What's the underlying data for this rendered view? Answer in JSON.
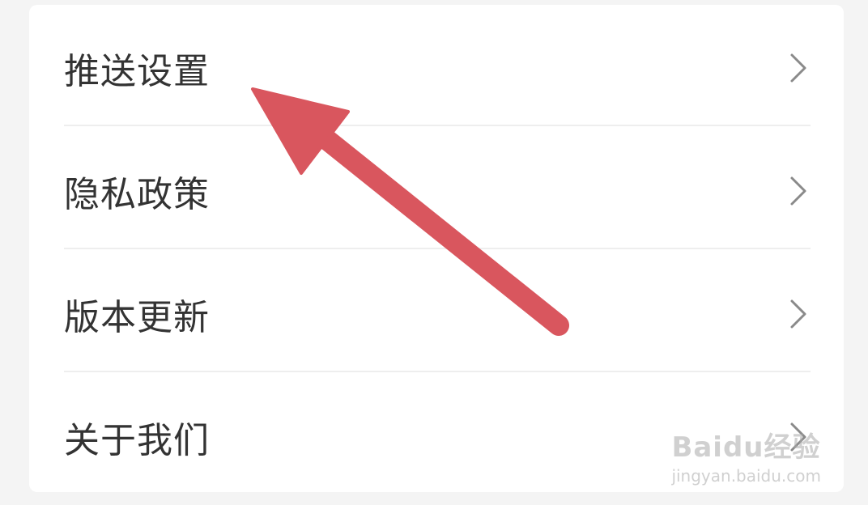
{
  "settings_list": {
    "items": [
      {
        "label": "推送设置",
        "icon": "chevron-right-icon"
      },
      {
        "label": "隐私政策",
        "icon": "chevron-right-icon"
      },
      {
        "label": "版本更新",
        "icon": "chevron-right-icon"
      },
      {
        "label": "关于我们",
        "icon": "chevron-right-icon"
      }
    ]
  },
  "overlay": {
    "arrow_color": "#d9565e",
    "arrow_target": "推送设置"
  },
  "watermark": {
    "brand": "Baidu经验",
    "url": "jingyan.baidu.com"
  }
}
